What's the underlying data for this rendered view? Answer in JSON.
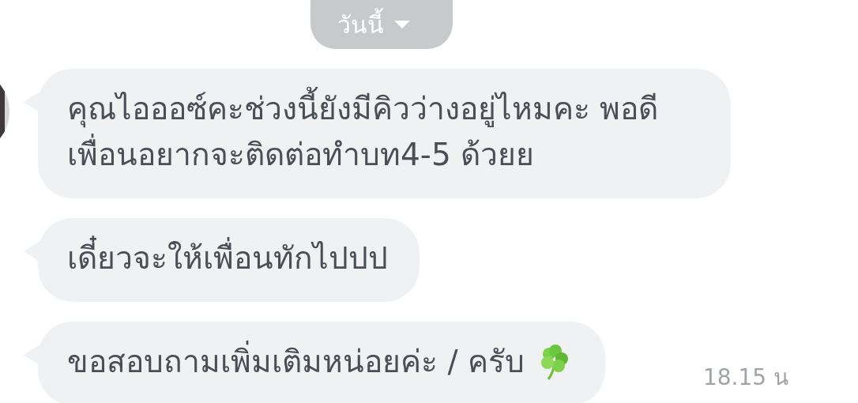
{
  "date_pill": {
    "label": "วันนี้"
  },
  "messages": [
    {
      "text": "คุณไอออซ์คะช่วงนี้ยังมีคิวว่างอยู่ไหมคะ พอดีเพื่อนอยากจะติดต่อทำบท4-5 ด้วยย",
      "tail": true,
      "emoji": false
    },
    {
      "text": "เดี๋ยวจะให้เพื่อนทักไปปป",
      "tail": true,
      "emoji": false
    },
    {
      "text": "ขอสอบถามเพิ่มเติมหน่อยค่ะ / ครับ",
      "tail": true,
      "emoji": true
    }
  ],
  "time": "18.15 น"
}
